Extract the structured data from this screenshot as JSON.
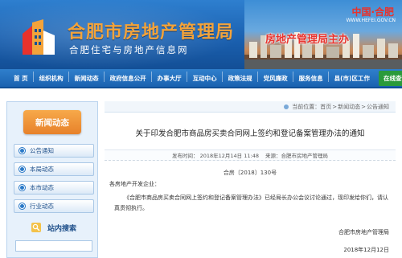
{
  "header": {
    "site_title": "合肥市房地产管理局",
    "site_subtitle": "合肥住宅与房地产信息网",
    "city_brand": "中国·合肥",
    "city_url": "WWW.HEFEI.GOV.CN",
    "city_slogan": "房地产管理局主办"
  },
  "nav": {
    "items": [
      "首 页",
      "组织机构",
      "新闻动态",
      "政府信息公开",
      "办事大厅",
      "互动中心",
      "政策法规",
      "党风廉政",
      "服务信息",
      "县(市)区工作",
      "在线查询"
    ]
  },
  "sidebar": {
    "tab_label": "新闻动态",
    "items": [
      "公告通知",
      "本局动态",
      "本市动态",
      "行业动态"
    ],
    "search_label": "站内搜索"
  },
  "breadcrumb": {
    "prefix": "当前位置：",
    "parts": [
      "首页",
      "新闻动态",
      "公告通知"
    ],
    "sep": ">"
  },
  "article": {
    "title": "关于印发合肥市商品房买卖合同网上签约和登记备案管理办法的通知",
    "publish_time": "发布时间： 2018年12月14日 11:48",
    "source": "来源：合肥市房地产管理局",
    "doc_number": "合房〔2018〕130号",
    "salutation": "各房地产开发企业：",
    "body": "《合肥市商品房买卖合同网上签约和登记备案管理办法》已经局长办公会议讨论通过，现印发给你们，请认真贯彻执行。",
    "issuer": "合肥市房地产管理局",
    "date": "2018年12月12日"
  },
  "colors": {
    "header_blue": "#1a5fae",
    "title_orange": "#f3a33a",
    "tab_orange": "#e7812a",
    "query_green": "#2a9a3b",
    "slogan_red": "#e8322c"
  }
}
